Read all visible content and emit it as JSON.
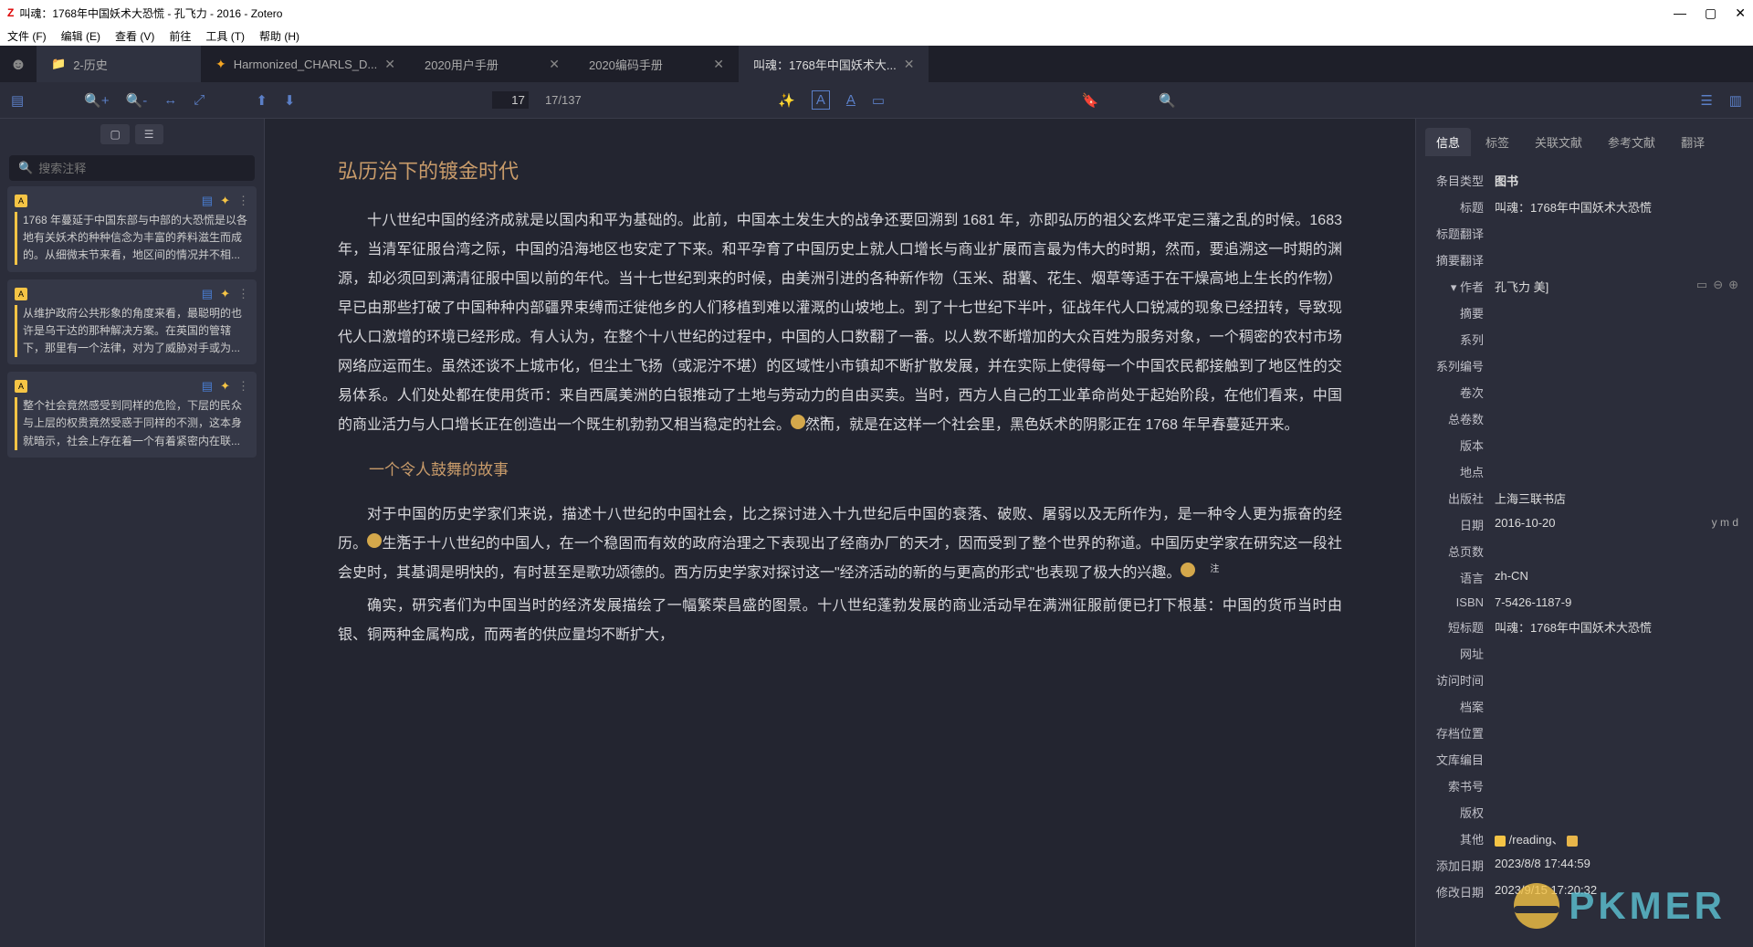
{
  "window": {
    "title": "叫魂：1768年中国妖术大恐慌 - 孔飞力 - 2016 - Zotero"
  },
  "menu": {
    "file": "文件 (F)",
    "edit": "编辑 (E)",
    "view": "查看 (V)",
    "go": "前往",
    "tools": "工具 (T)",
    "help": "帮助 (H)"
  },
  "tabs": {
    "collection": "2-历史",
    "t1": "Harmonized_CHARLS_D...",
    "t2": "2020用户手册",
    "t3": "2020编码手册",
    "t4": "叫魂：1768年中国妖术大..."
  },
  "toolbar": {
    "page_current": "17",
    "page_total": "17/137"
  },
  "annotations": {
    "search_placeholder": "搜索注释",
    "items": [
      {
        "text": "1768 年蔓延于中国东部与中部的大恐慌是以各地有关妖术的种种信念为丰富的养料滋生而成的。从细微末节来看，地区间的情况并不相..."
      },
      {
        "text": "从维护政府公共形象的角度来看，最聪明的也许是乌干达的那种解决方案。在英国的管辖下，那里有一个法律，对为了威胁对手或为..."
      },
      {
        "text": "整个社会竟然感受到同样的危险，下层的民众与上层的权贵竟然受惑于同样的不测，这本身就暗示，社会上存在着一个有着紧密内在联..."
      }
    ]
  },
  "reader": {
    "heading": "弘历治下的镀金时代",
    "p1a": "十八世纪中国的经济成就是以国内和平为基础的。此前，中国本土发生大的战争还要回溯到 1681 年，亦即弘历的祖父玄烨平定三藩之乱的时候。1683 年，当清军征服台湾之际，中国的沿海地区也安定了下来。和平孕育了中国历史上就人口增长与商业扩展而言最为伟大的时期，然而，要追溯这一时期的渊源，却必须回到满清征服中国以前的年代。当十七世纪到来的时候，由美洲引进的各种新作物（玉米、甜薯、花生、烟草等适于在干燥高地上生长的作物）早已由那些打破了中国种种内部疆界束缚而迁徙他乡的人们移植到难以灌溉的山坡地上。到了十七世纪下半叶，征战年代人口锐减的现象已经扭转，导致现代人口激增的环境已经形成。有人认为，在整个十八世纪的过程中，中国的人口数翻了一番。以人数不断增加的大众百姓为服务对象，一个稠密的农村市场网络应运而生。虽然还谈不上城市化，但尘土飞扬（或泥泞不堪）的区域性小市镇却不断扩散发展，并在实际上使得每一个中国农民都接触到了地区性的交易体系。人们处处都在使用货币：来自西属美洲的白银推动了土地与劳动力的自由买卖。当时，西方人自己的工业革命尚处于起始阶段，在他们看来，中国的商业活力与人口增长正在创造出一个既生机勃勃又相当稳定的社会。",
    "p1b": "然而，就是在这样一个社会里，黑色妖术的阴影正在 1768 年早春蔓延开来。",
    "subheading": "一个令人鼓舞的故事",
    "p2a": "对于中国的历史学家们来说，描述十八世纪的中国社会，比之探讨进入十九世纪后中国的衰落、破败、屠弱以及无所作为，是一种令人更为振奋的经历。",
    "p2b": "生活于十八世纪的中国人，在一个稳固而有效的政府治理之下表现出了经商办厂的天才，因而受到了整个世界的称道。中国历史学家在研究这一段社会史时，其基调是明快的，有时甚至是歌功颂德的。西方历史学家对探讨这一\"经济活动的新的与更高的形式\"也表现了极大的兴趣。",
    "p3": "确实，研究者们为中国当时的经济发展描绘了一幅繁荣昌盛的图景。十八世纪蓬勃发展的商业活动早在满洲征服前便已打下根基：中国的货币当时由银、铜两种金属构成，而两者的供应量均不断扩大，"
  },
  "info_tabs": {
    "info": "信息",
    "tags": "标签",
    "related": "关联文献",
    "refs": "参考文献",
    "translate": "翻译"
  },
  "fields": {
    "type_label": "条目类型",
    "type_value": "图书",
    "title_label": "标题",
    "title_value": "叫魂：1768年中国妖术大恐慌",
    "title_trans_label": "标题翻译",
    "abstract_trans_label": "摘要翻译",
    "author_label": "作者",
    "author_value": "孔飞力  美]",
    "abstract_label": "摘要",
    "series_label": "系列",
    "series_no_label": "系列编号",
    "volume_label": "卷次",
    "volumes_label": "总卷数",
    "edition_label": "版本",
    "place_label": "地点",
    "publisher_label": "出版社",
    "publisher_value": "上海三联书店",
    "date_label": "日期",
    "date_value": "2016-10-20",
    "date_hint": "y m d",
    "pages_label": "总页数",
    "lang_label": "语言",
    "lang_value": "zh-CN",
    "isbn_label": "ISBN",
    "isbn_value": "7-5426-1187-9",
    "short_label": "短标题",
    "short_value": "叫魂：1768年中国妖术大恐慌",
    "url_label": "网址",
    "accessed_label": "访问时间",
    "archive_label": "档案",
    "loc_label": "存档位置",
    "catalog_label": "文库编目",
    "call_label": "索书号",
    "rights_label": "版权",
    "extra_label": "其他",
    "extra_value": "/reading、",
    "added_label": "添加日期",
    "added_value": "2023/8/8 17:44:59",
    "modified_label": "修改日期",
    "modified_value": "2023/9/15 17:20:32"
  },
  "watermark": "PKMER"
}
